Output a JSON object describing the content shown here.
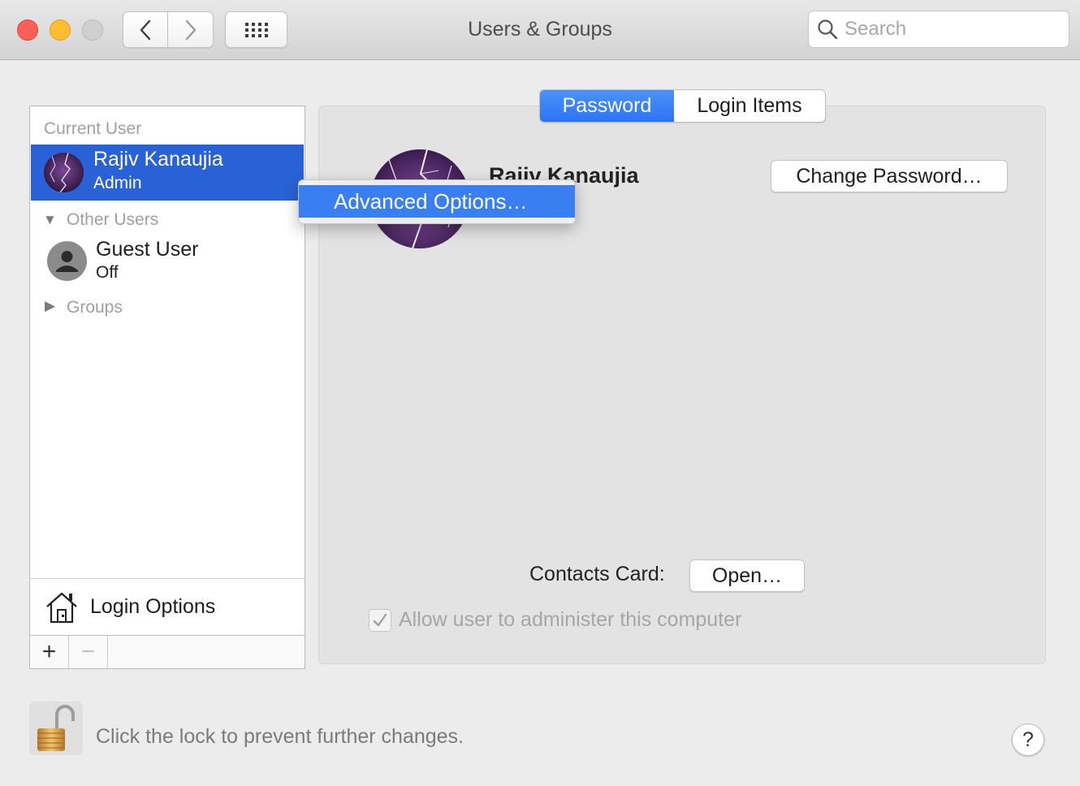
{
  "window": {
    "title": "Users & Groups"
  },
  "toolbar": {
    "back_icon": "chevron-left-icon",
    "forward_icon": "chevron-right-icon",
    "grid_icon": "show-all-grid-icon",
    "search": {
      "placeholder": "Search",
      "value": ""
    }
  },
  "sidebar": {
    "current_user_header": "Current User",
    "current_user": {
      "name": "Rajiv Kanaujia",
      "role": "Admin"
    },
    "other_users_header": "Other Users",
    "other_users": [
      {
        "name": "Guest User",
        "status": "Off"
      }
    ],
    "groups_header": "Groups",
    "login_options_label": "Login Options",
    "add_label": "+",
    "remove_label": "−"
  },
  "tabs": [
    {
      "label": "Password",
      "active": true
    },
    {
      "label": "Login Items",
      "active": false
    }
  ],
  "detail": {
    "user_name": "Rajiv Kanaujia",
    "change_password_label": "Change Password…",
    "contacts_card_label": "Contacts Card:",
    "open_label": "Open…",
    "allow_admin_label": "Allow user to administer this computer",
    "allow_admin_checked": true
  },
  "context_menu": {
    "items": [
      "Advanced Options…"
    ]
  },
  "footer": {
    "lock_text": "Click the lock to prevent further changes.",
    "help_label": "?"
  },
  "colors": {
    "selection_blue": "#2862d6",
    "tab_active_blue": "#2d74f3",
    "menu_highlight": "#3a7ff1",
    "close": "#fe5f57",
    "minimize": "#febc2e"
  }
}
